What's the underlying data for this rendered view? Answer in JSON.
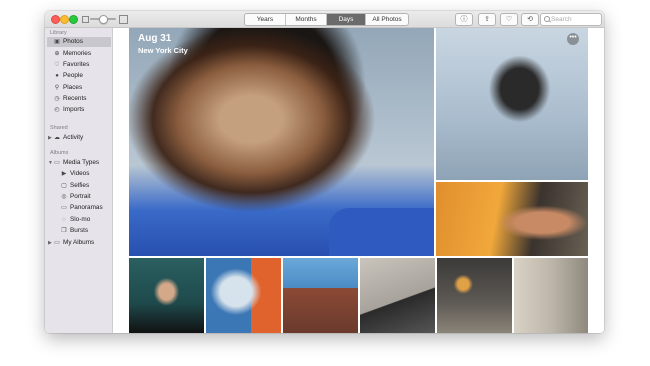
{
  "window": {
    "view_tabs": [
      "Years",
      "Months",
      "Days",
      "All Photos"
    ],
    "active_tab": "Days",
    "toolbar_icons": [
      "info-icon",
      "share-icon",
      "heart-icon",
      "rotate-icon"
    ],
    "search_placeholder": "Search"
  },
  "sidebar": {
    "library_header": "Library",
    "library_items": [
      {
        "label": "Photos",
        "icon": "photos-icon",
        "selected": true
      },
      {
        "label": "Memories",
        "icon": "memories-icon"
      },
      {
        "label": "Favorites",
        "icon": "heart-icon"
      },
      {
        "label": "People",
        "icon": "person-icon"
      },
      {
        "label": "Places",
        "icon": "pin-icon"
      },
      {
        "label": "Recents",
        "icon": "clock-icon"
      },
      {
        "label": "Imports",
        "icon": "import-icon"
      }
    ],
    "shared_header": "Shared",
    "shared_items": [
      {
        "label": "Activity",
        "icon": "cloud-icon"
      }
    ],
    "albums_header": "Albums",
    "album_items": [
      {
        "label": "Media Types",
        "icon": "folder-icon"
      },
      {
        "label": "Videos",
        "icon": "video-icon"
      },
      {
        "label": "Selfies",
        "icon": "selfie-icon"
      },
      {
        "label": "Portrait",
        "icon": "portrait-icon"
      },
      {
        "label": "Panoramas",
        "icon": "panorama-icon"
      },
      {
        "label": "Slo-mo",
        "icon": "slomo-icon"
      },
      {
        "label": "Bursts",
        "icon": "burst-icon"
      },
      {
        "label": "My Albums",
        "icon": "folder-icon"
      }
    ]
  },
  "main": {
    "date_title": "Aug 31",
    "location": "New York City",
    "more_button": "•••"
  }
}
